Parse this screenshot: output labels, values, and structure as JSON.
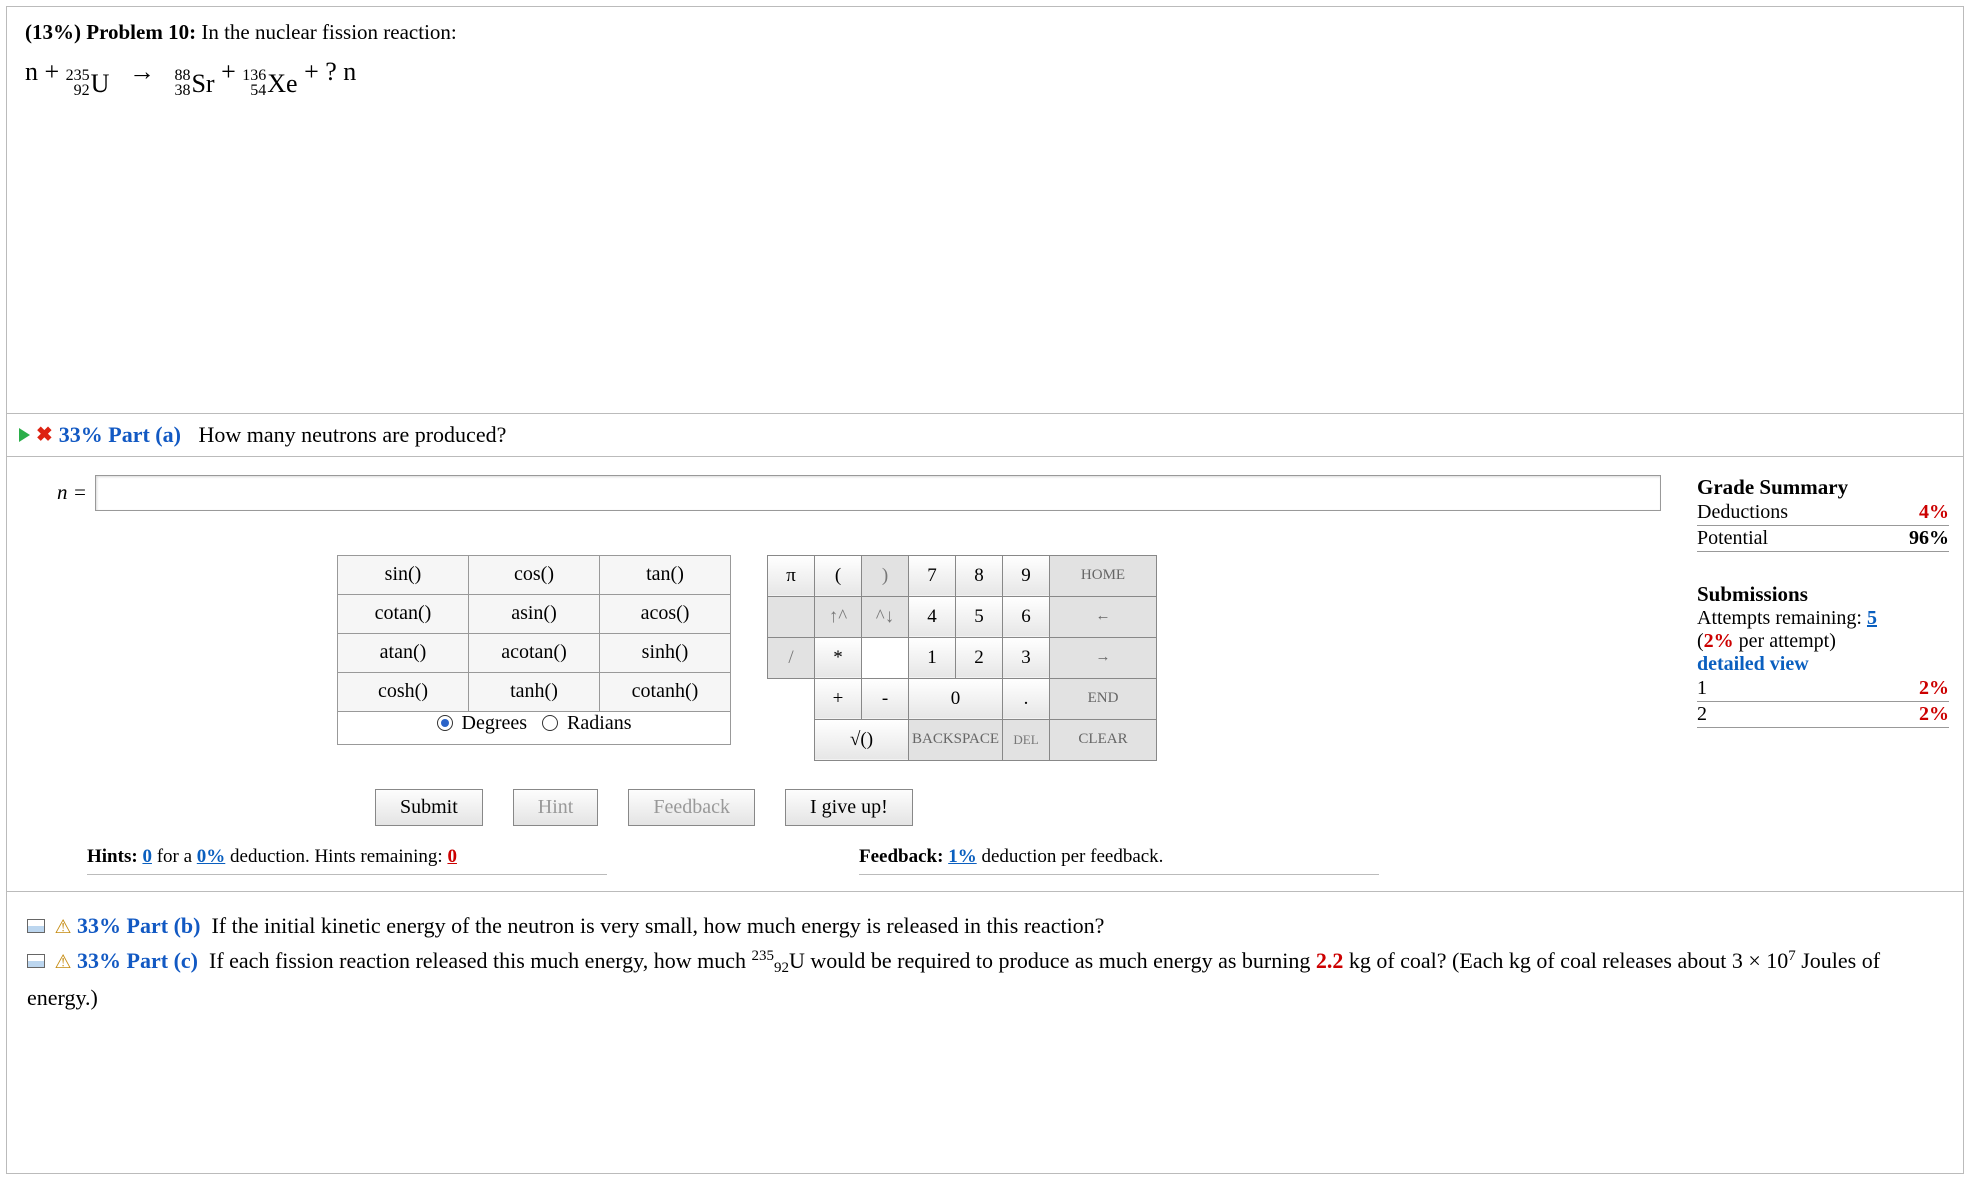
{
  "problem": {
    "header_prefix": "(13%) Problem 10:",
    "header_text": "In the nuclear fission reaction:",
    "equation": {
      "lhs_prefix": "n +",
      "iso_U": {
        "mass": "235",
        "atomic": "92",
        "symbol": "U"
      },
      "arrow": "→",
      "iso_Sr": {
        "mass": "88",
        "atomic": "38",
        "symbol": "Sr"
      },
      "plus": "+",
      "iso_Xe": {
        "mass": "136",
        "atomic": "54",
        "symbol": "Xe"
      },
      "tail": "+ ? n"
    }
  },
  "partA": {
    "tri": "▶",
    "close": "✖",
    "weight": "33%",
    "label": "Part (a)",
    "question": "How many neutrons are produced?",
    "answer_symbol": "n =",
    "answer_value": "",
    "fn": [
      [
        "sin()",
        "cos()",
        "tan()"
      ],
      [
        "cotan()",
        "asin()",
        "acos()"
      ],
      [
        "atan()",
        "acotan()",
        "sinh()"
      ],
      [
        "cosh()",
        "tanh()",
        "cotanh()"
      ]
    ],
    "deg_label": "Degrees",
    "rad_label": "Radians",
    "keypad": {
      "pi": "π",
      "lp": "(",
      "rp": ")",
      "home": "HOME",
      "left": "←",
      "right": "→",
      "end": "END",
      "up": "↑^",
      "down": "^↓",
      "slash": "/",
      "star": "*",
      "plus": "+",
      "minus": "-",
      "dot": ".",
      "sqrt": "√()",
      "back": "BACKSPACE",
      "del": "DEL",
      "clear": "CLEAR",
      "d7": "7",
      "d8": "8",
      "d9": "9",
      "d4": "4",
      "d5": "5",
      "d6": "6",
      "d1": "1",
      "d2": "2",
      "d3": "3",
      "d0": "0"
    },
    "buttons": {
      "submit": "Submit",
      "hint": "Hint",
      "feedback": "Feedback",
      "giveup": "I give up!"
    },
    "hints_line": {
      "prefix": "Hints:",
      "hints_count": "0",
      "for_a": "for a",
      "hint_pct": "0%",
      "ded": "deduction. Hints remaining:",
      "hints_left": "0"
    },
    "feedback_line": {
      "prefix": "Feedback:",
      "fb_pct": "1%",
      "tail": "deduction per feedback."
    }
  },
  "gradeSummary": {
    "title": "Grade Summary",
    "rows": [
      {
        "label": "Deductions",
        "value": "4%",
        "value_red": true
      },
      {
        "label": "Potential",
        "value": "96%",
        "value_red": false
      }
    ],
    "sub_title": "Submissions",
    "attempts_text": "Attempts remaining:",
    "attempts_left": "5",
    "per_attempt": "(2% per attempt)",
    "detailed": "detailed view",
    "history": [
      {
        "n": "1",
        "v": "2%"
      },
      {
        "n": "2",
        "v": "2%"
      }
    ]
  },
  "partsBelow": {
    "b_weight": "33%",
    "b_label": "Part (b)",
    "b_text": "If the initial kinetic energy of the neutron is very small, how much energy is released in this reaction?",
    "c_weight": "33%",
    "c_label": "Part (c)",
    "c_text_1": "If each fission reaction released this much energy, how much ",
    "c_iso": {
      "mass": "235",
      "atomic": "92",
      "symbol": "U"
    },
    "c_text_2": " would be required to produce as much energy as burning ",
    "c_val": "2.2",
    "c_text_3": " kg of coal? (Each kg of coal releases about 3 × 10",
    "c_exp": "7",
    "c_text_4": " Joules of energy.)"
  }
}
